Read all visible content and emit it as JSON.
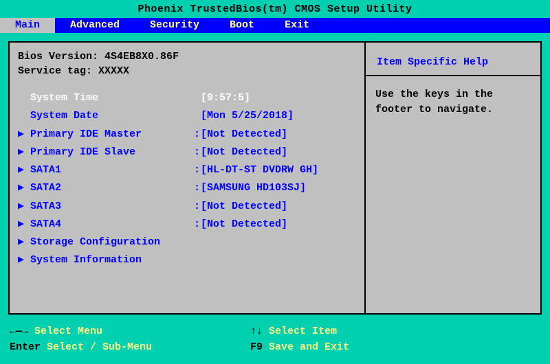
{
  "title": "Phoenix TrustedBios(tm) CMOS Setup Utility",
  "tabs": [
    {
      "label": "Main",
      "active": true
    },
    {
      "label": "Advanced",
      "active": false
    },
    {
      "label": "Security",
      "active": false
    },
    {
      "label": "Boot",
      "active": false
    },
    {
      "label": "Exit",
      "active": false
    }
  ],
  "info": {
    "bios_label": "Bios Version:",
    "bios_value": "4S4EB8X0.86F",
    "svc_label": "Service tag:",
    "svc_value": "XXXXX"
  },
  "rows": [
    {
      "type": "field",
      "selected": true,
      "label": "System Time",
      "value": "[9:57:5]"
    },
    {
      "type": "field",
      "selected": false,
      "label": "System Date",
      "value": "[Mon 5/25/2018]"
    },
    {
      "type": "sub",
      "selected": false,
      "label": "Primary IDE Master",
      "value": "[Not Detected]"
    },
    {
      "type": "sub",
      "selected": false,
      "label": "Primary IDE Slave",
      "value": "[Not Detected]"
    },
    {
      "type": "sub",
      "selected": false,
      "label": "SATA1",
      "value": "[HL-DT-ST DVDRW GH]"
    },
    {
      "type": "sub",
      "selected": false,
      "label": "SATA2",
      "value": "[SAMSUNG HD103SJ]"
    },
    {
      "type": "sub",
      "selected": false,
      "label": "SATA3",
      "value": "[Not Detected]"
    },
    {
      "type": "sub",
      "selected": false,
      "label": "SATA4",
      "value": "[Not Detected]"
    },
    {
      "type": "sub",
      "selected": false,
      "label": "Storage Configuration",
      "value": ""
    },
    {
      "type": "sub",
      "selected": false,
      "label": "System Information",
      "value": ""
    }
  ],
  "help": {
    "title": "Item Specific Help",
    "body": "Use the keys in the footer to navigate."
  },
  "footer": {
    "left1_key": "←—→",
    "left1_txt": " Select Menu",
    "right1_key": "↑↓",
    "right1_txt": " Select Item",
    "left2_key": "Enter",
    "left2_txt": " Select / Sub-Menu",
    "right2_key": "F9",
    "right2_txt": " Save and Exit"
  }
}
